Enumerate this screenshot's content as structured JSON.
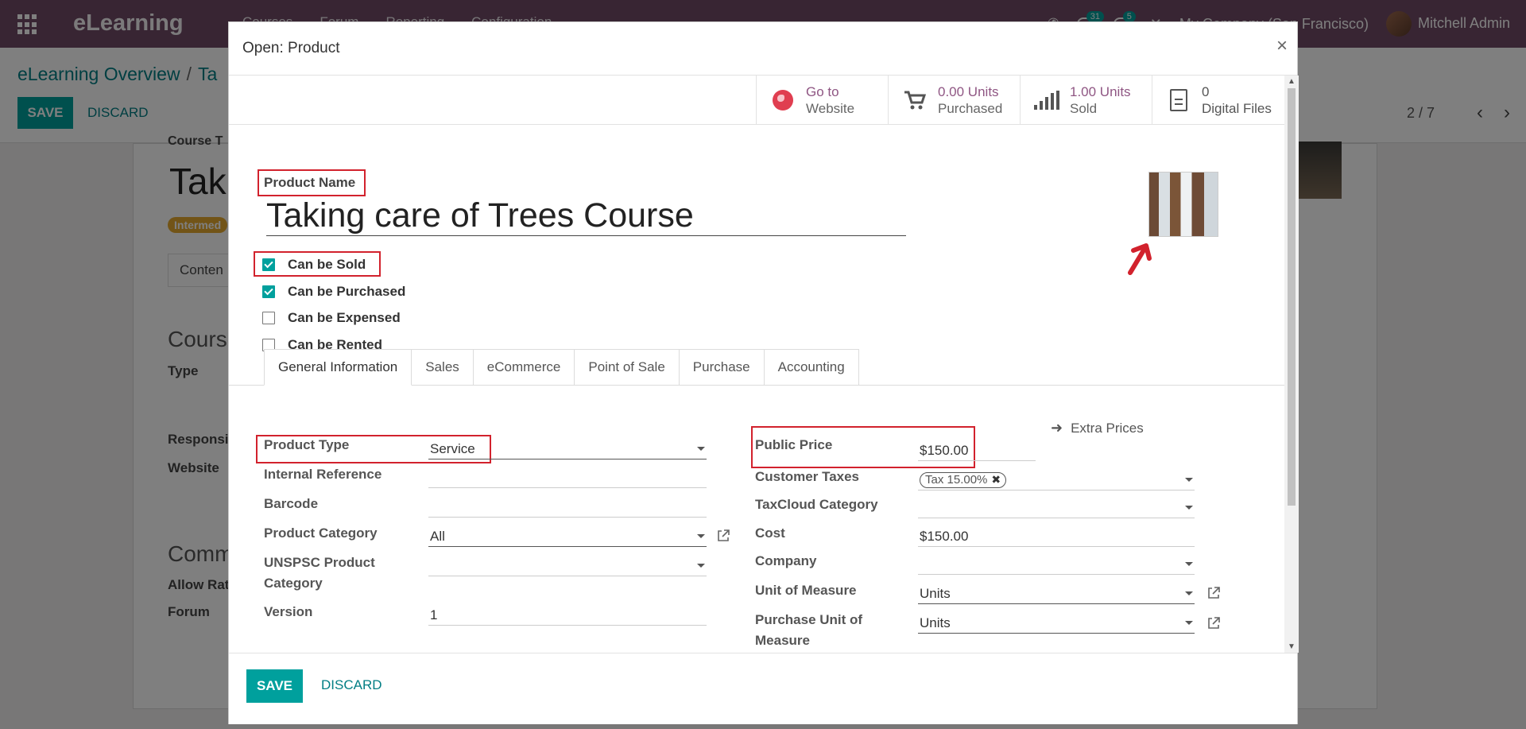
{
  "app": {
    "brand": "eLearning",
    "menu": [
      "Courses",
      "Forum",
      "Reporting",
      "Configuration"
    ],
    "activity_count": "31",
    "message_count": "5",
    "company": "My Company (San Francisco)",
    "user": "Mitchell Admin"
  },
  "control_panel": {
    "breadcrumb_root": "eLearning Overview",
    "breadcrumb_sep": "/",
    "breadcrumb_current": "Ta",
    "save_label": "SAVE",
    "discard_label": "DISCARD",
    "pager": "2 / 7"
  },
  "background_form": {
    "course_title_label": "Course T",
    "course_title": "Taki",
    "level_badge": "Intermed",
    "content_tab": "Conten",
    "section_course": "Course",
    "type_label": "Type",
    "responsible_label": "Responsi",
    "website_label": "Website",
    "section_comm": "Comm",
    "allow_rating_label": "Allow Rat",
    "forum_label": "Forum"
  },
  "modal": {
    "title": "Open: Product",
    "close_glyph": "×",
    "smart_buttons": [
      {
        "value": "Go to",
        "label": "Website",
        "icon": "globe-icon"
      },
      {
        "value": "0.00 Units",
        "label": "Purchased",
        "icon": "shopping-cart-icon"
      },
      {
        "value": "1.00 Units",
        "label": "Sold",
        "icon": "bar-chart-icon"
      },
      {
        "value": "0",
        "label": "Digital Files",
        "icon": "file-icon"
      }
    ],
    "product_name_label": "Product Name",
    "product_name": "Taking care of Trees Course",
    "checkboxes": [
      {
        "label": "Can be Sold",
        "checked": true
      },
      {
        "label": "Can be Purchased",
        "checked": true
      },
      {
        "label": "Can be Expensed",
        "checked": false
      },
      {
        "label": "Can be Rented",
        "checked": false
      }
    ],
    "tabs": [
      "General Information",
      "Sales",
      "eCommerce",
      "Point of Sale",
      "Purchase",
      "Accounting"
    ],
    "left_fields": {
      "product_type_label": "Product Type",
      "product_type": "Service",
      "internal_reference_label": "Internal Reference",
      "internal_reference": "",
      "barcode_label": "Barcode",
      "barcode": "",
      "product_category_label": "Product Category",
      "product_category": "All",
      "unspsc_label_1": "UNSPSC Product",
      "unspsc_label_2": "Category",
      "unspsc": "",
      "version_label": "Version",
      "version": "1"
    },
    "right_fields": {
      "public_price_label": "Public Price",
      "public_price": "$150.00",
      "extra_prices": "Extra Prices",
      "customer_taxes_label": "Customer Taxes",
      "tax_tag": "Tax 15.00%",
      "taxcloud_label": "TaxCloud Category",
      "taxcloud": "",
      "cost_label": "Cost",
      "cost": "$150.00",
      "company_label": "Company",
      "company": "",
      "uom_label": "Unit of Measure",
      "uom": "Units",
      "purchase_uom_label_1": "Purchase Unit of",
      "purchase_uom_label_2": "Measure",
      "purchase_uom": "Units"
    },
    "footer": {
      "save_label": "SAVE",
      "discard_label": "DISCARD"
    }
  },
  "colors": {
    "brand": "#714b67",
    "accent": "#00a09d",
    "highlight": "#d2222d",
    "link": "#017e84"
  }
}
